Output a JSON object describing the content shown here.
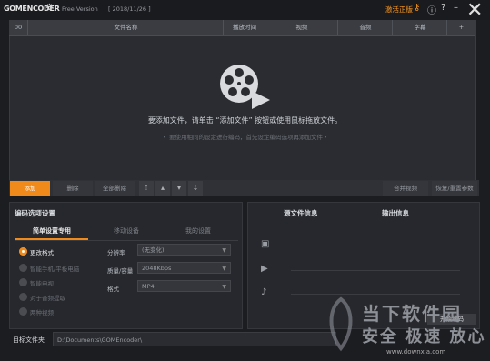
{
  "titlebar": {
    "logo": "GOMENCODER",
    "version": "Free Version",
    "date": "[ 2018/11/26 ]",
    "activate": "激活正版",
    "icons": [
      "gear-icon",
      "key-icon",
      "info-icon",
      "help-icon",
      "minimize-icon",
      "close-icon"
    ]
  },
  "filelist": {
    "columns": [
      "文件名称",
      "播放时间",
      "视频",
      "音频",
      "字幕",
      "+"
    ],
    "first_col": "00",
    "empty_hint": "要添加文件，请单击 “添加文件” 按钮或使用鼠标拖放文件。",
    "empty_subhint": "・ 要使用相同的设定进行编码，首先设定编码选项再添加文件・"
  },
  "toolbar": {
    "add": "添加",
    "delete": "删除",
    "delete_all": "全部删除",
    "merge": "合并视频",
    "reset": "恢复/重置参数",
    "order_buttons": [
      "move-top-icon",
      "move-up-icon",
      "move-down-icon",
      "move-bottom-icon"
    ]
  },
  "encoding": {
    "title": "编码选项设置",
    "tabs": [
      "简单设置专用",
      "移动设备",
      "我的设置"
    ],
    "active_tab": 0,
    "presets": [
      "更改格式",
      "智能手机/平板电脑",
      "智能电视",
      "对于音频提取",
      "两种视频"
    ],
    "selected_preset": 0,
    "fields": [
      {
        "label": "分辨率",
        "value": "(无变化)"
      },
      {
        "label": "质量/容量",
        "value": "2048Kbps"
      },
      {
        "label": "格式",
        "value": "MP4"
      }
    ]
  },
  "info": {
    "source_title": "源文件信息",
    "output_title": "输出信息",
    "icons": [
      "file-icon",
      "video-camera-icon",
      "music-icon"
    ]
  },
  "output": {
    "label": "目标文件夹",
    "path": "D:\\Documents\\GOMEncoder\\",
    "start": "开始编码"
  },
  "watermark": {
    "line1": "当下软件园",
    "line2": "安全 极速 放心",
    "url": "www.downxia.com"
  },
  "colors": {
    "accent": "#f08a1a",
    "background": "#1c1d21",
    "panel": "#26282d"
  }
}
